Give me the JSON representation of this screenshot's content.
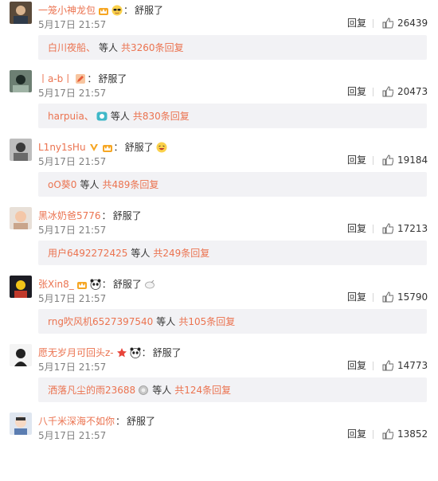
{
  "ui": {
    "reply_label": "回复",
    "etc_label": "等人",
    "colon": "："
  },
  "colors": {
    "username": "#eb7350",
    "reply_bar_bg": "#f2f2f5",
    "meta_gray": "#808080"
  },
  "comments": [
    {
      "username": "一笼小神龙包",
      "badges": [
        "crown-icon",
        "sunglasses-emoji-icon"
      ],
      "content": "舒服了",
      "date": "5月17日 21:57",
      "likes": "26439",
      "sub": {
        "user": "白川夜船、",
        "badge": "",
        "count": "共3260条回复"
      }
    },
    {
      "username": "丨a-b丨",
      "badges": [
        "pencil-emoji-icon"
      ],
      "content": "舒服了",
      "date": "5月17日 21:57",
      "likes": "20473",
      "sub": {
        "user": "harpuia、",
        "badge": "member-icon",
        "count": "共830条回复"
      }
    },
    {
      "username": "L1ny1sHu",
      "badges": [
        "v-badge-icon",
        "crown-icon"
      ],
      "content": "舒服了",
      "date": "5月17日 21:57",
      "likes": "19184",
      "sub": {
        "user": "oO葵0",
        "badge": "",
        "count": "共489条回复"
      }
    },
    {
      "username": "黑冰奶爸5776",
      "badges": [],
      "content": "舒服了",
      "date": "5月17日 21:57",
      "likes": "17213",
      "sub": {
        "user": "用户6492272425",
        "badge": "",
        "count": "共249条回复"
      }
    },
    {
      "username": "张Xin8_",
      "badges": [
        "crown-icon",
        "panda-emoji-icon"
      ],
      "content": "舒服了",
      "date": "5月17日 21:57",
      "likes": "15790",
      "sub": {
        "user": "rng吹风机6527397540",
        "badge": "",
        "count": "共105条回复"
      }
    },
    {
      "username": "愿无岁月可回头z-",
      "badges": [
        "star-icon",
        "panda-emoji-icon"
      ],
      "content": "舒服了",
      "date": "5月17日 21:57",
      "likes": "14773",
      "sub": {
        "user": "洒落凡尘的雨23688",
        "badge": "silver-badge-icon",
        "count": "共124条回复"
      }
    },
    {
      "username": "八千米深海不如你",
      "badges": [],
      "content": "舒服了",
      "date": "5月17日 21:57",
      "likes": "13852",
      "sub": null
    }
  ]
}
